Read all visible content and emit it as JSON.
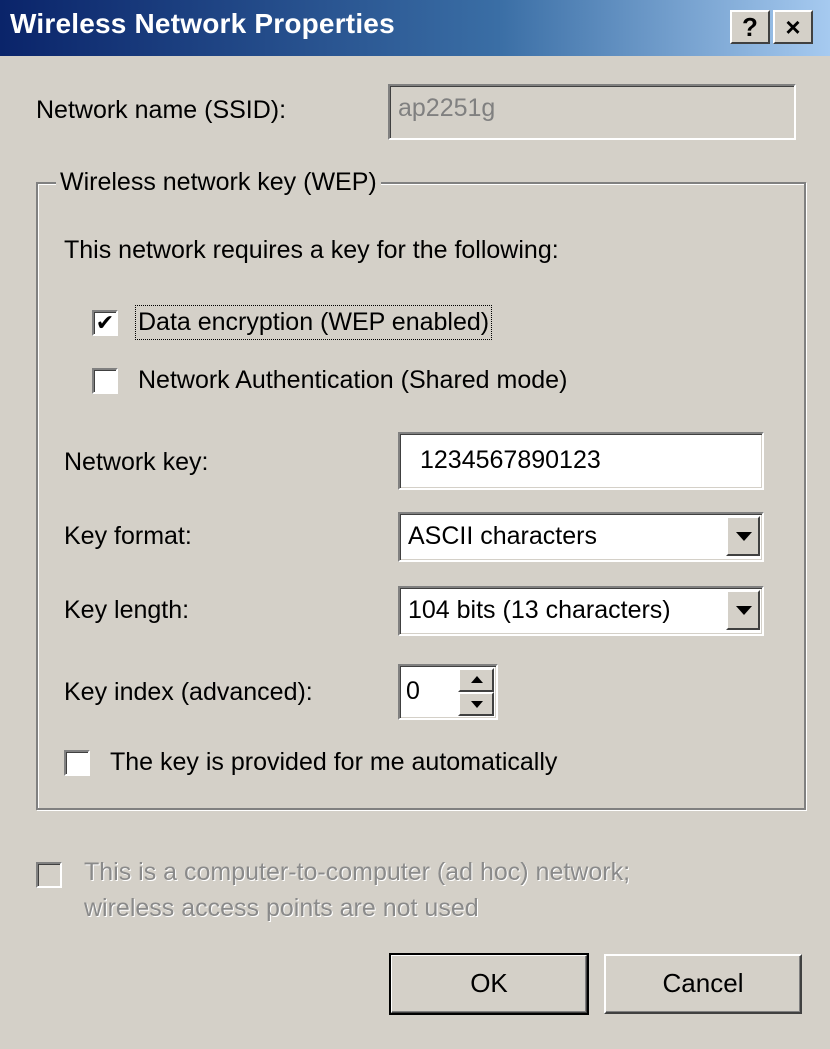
{
  "window": {
    "title": "Wireless Network Properties",
    "help_label": "?",
    "close_label": "×"
  },
  "ssid": {
    "label": "Network name (SSID):",
    "value": "ap2251g"
  },
  "wep_group": {
    "legend": "Wireless network key (WEP)",
    "requires_text": "This network requires a key for the following:",
    "data_encryption": {
      "label": "Data encryption (WEP enabled)",
      "checked": true,
      "mark": "✔"
    },
    "network_auth": {
      "label": "Network Authentication (Shared mode)",
      "checked": false,
      "mark": ""
    },
    "network_key": {
      "label": "Network key:",
      "value": "1234567890123"
    },
    "key_format": {
      "label": "Key format:",
      "selected": "ASCII characters"
    },
    "key_length": {
      "label": "Key length:",
      "selected": "104 bits (13 characters)"
    },
    "key_index": {
      "label": "Key index (advanced):",
      "value": "0"
    },
    "auto_key": {
      "label": "The key is provided for me automatically",
      "checked": false,
      "mark": ""
    }
  },
  "adhoc": {
    "line1": "This is a computer-to-computer (ad hoc) network;",
    "line2": "wireless access points are not used",
    "checked": false,
    "enabled": false
  },
  "buttons": {
    "ok": "OK",
    "cancel": "Cancel"
  },
  "colors": {
    "title_bar_start": "#0a246a",
    "title_bar_end": "#a6caf0",
    "face": "#d4d0c8",
    "disabled_text": "#8a8a8a"
  }
}
